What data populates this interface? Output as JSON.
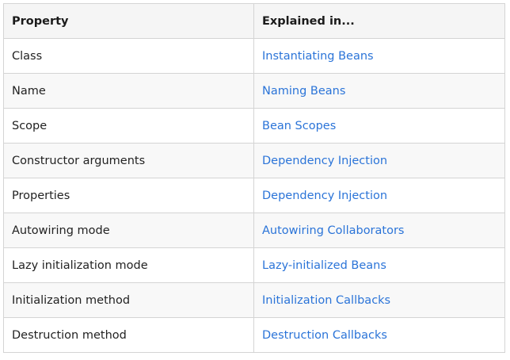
{
  "table": {
    "headers": [
      "Property",
      "Explained in..."
    ],
    "rows": [
      {
        "property": "Class",
        "link": "Instantiating Beans"
      },
      {
        "property": "Name",
        "link": "Naming Beans"
      },
      {
        "property": "Scope",
        "link": "Bean Scopes"
      },
      {
        "property": "Constructor arguments",
        "link": "Dependency Injection"
      },
      {
        "property": "Properties",
        "link": "Dependency Injection"
      },
      {
        "property": "Autowiring mode",
        "link": "Autowiring Collaborators"
      },
      {
        "property": "Lazy initialization mode",
        "link": "Lazy-initialized Beans"
      },
      {
        "property": "Initialization method",
        "link": "Initialization Callbacks"
      },
      {
        "property": "Destruction method",
        "link": "Destruction Callbacks"
      }
    ]
  },
  "colors": {
    "link": "#2b74d8",
    "border": "#d4d4d4",
    "header_bg": "#f5f5f5"
  }
}
